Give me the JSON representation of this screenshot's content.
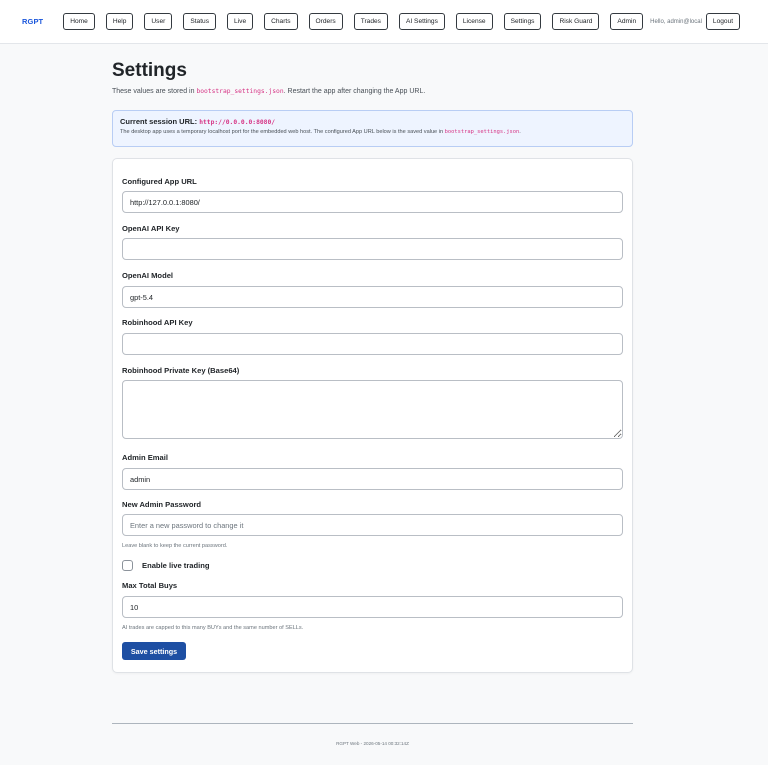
{
  "nav": {
    "brand": "RGPT",
    "links": [
      "Home",
      "Help",
      "User",
      "Status",
      "Live",
      "Charts",
      "Orders",
      "Trades",
      "AI Settings",
      "License",
      "Settings",
      "Risk Guard",
      "Admin"
    ],
    "greeting": "Hello, admin@local",
    "logout": "Logout"
  },
  "page": {
    "title": "Settings",
    "subtitle_prefix": "These values are stored in ",
    "subtitle_file": "bootstrap_settings.json",
    "subtitle_suffix": ". Restart the app after changing the App URL."
  },
  "session": {
    "label": "Current session URL:",
    "url": "http://0.0.0.0:8080/",
    "note_prefix": "The desktop app uses a temporary localhost port for the embedded web host. The configured App URL below is the saved value in ",
    "note_file": "bootstrap_settings.json",
    "note_suffix": "."
  },
  "form": {
    "app_url": {
      "label": "Configured App URL",
      "value": "http://127.0.0.1:8080/"
    },
    "openai_key": {
      "label": "OpenAI API Key",
      "value": ""
    },
    "openai_model": {
      "label": "OpenAI Model",
      "value": "gpt-5.4"
    },
    "robinhood_key": {
      "label": "Robinhood API Key",
      "value": ""
    },
    "robinhood_private": {
      "label": "Robinhood Private Key (Base64)",
      "value": ""
    },
    "admin_email": {
      "label": "Admin Email",
      "value": "admin"
    },
    "admin_password": {
      "label": "New Admin Password",
      "placeholder": "Enter a new password to change it",
      "help": "Leave blank to keep the current password."
    },
    "live_trading": {
      "label": "Enable live trading",
      "checked": false
    },
    "max_buys": {
      "label": "Max Total Buys",
      "value": "10",
      "help": "AI trades are capped to this many BUYs and the same number of SELLs."
    },
    "save": "Save settings"
  },
  "footer": {
    "text": "RGPT Web - 2026-05-14 00:32:14Z"
  }
}
